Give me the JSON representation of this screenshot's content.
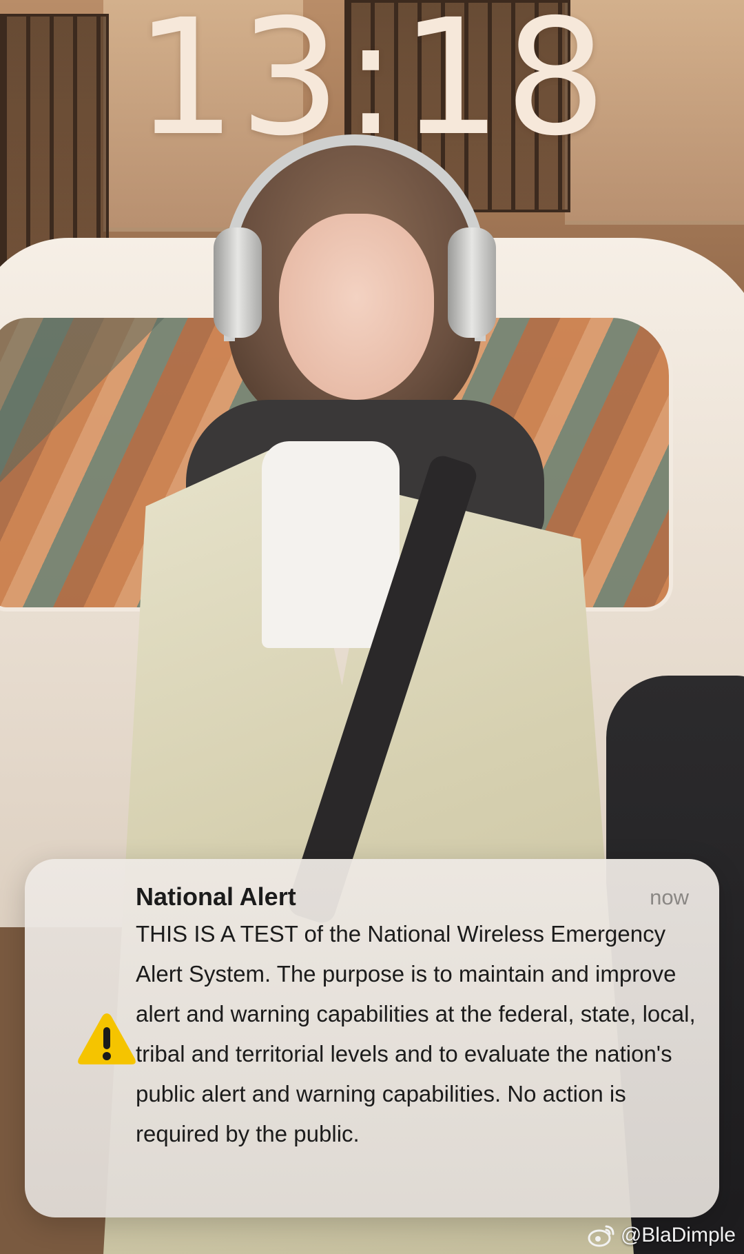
{
  "lock_screen": {
    "time": "13:18"
  },
  "notification": {
    "title": "National Alert",
    "timestamp": "now",
    "icon": "warning-triangle-icon",
    "icon_color": "#f5c400",
    "body": "THIS IS A TEST of the National Wireless Emergency Alert System. The purpose is to maintain and improve alert and warning capabilities at the federal, state, local, tribal and territorial levels and to evaluate the nation's public alert and warning capabilities. No action is required by the public."
  },
  "watermark": {
    "icon": "weibo-logo",
    "handle": "@BlaDimple"
  }
}
